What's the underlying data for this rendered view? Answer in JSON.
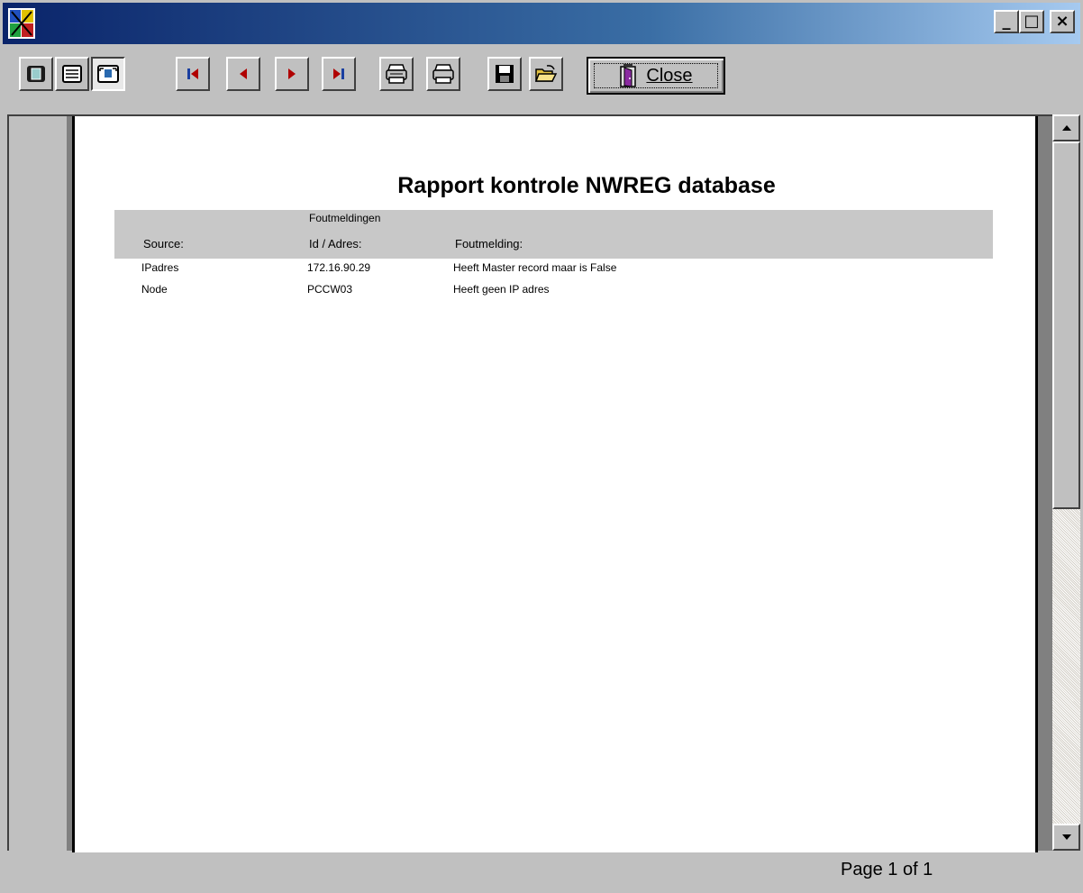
{
  "window": {
    "title": "",
    "controls": {
      "minimize": "_",
      "maximize": "□",
      "close": "×"
    }
  },
  "toolbar": {
    "buttons": [
      {
        "name": "one-page-view",
        "icon": "single-page-icon"
      },
      {
        "name": "list-view",
        "icon": "list-lines-icon"
      },
      {
        "name": "zoom-view",
        "icon": "zoom-page-icon"
      },
      {
        "name": "first-page",
        "icon": "first-page-icon"
      },
      {
        "name": "previous-page",
        "icon": "previous-page-icon"
      },
      {
        "name": "next-page",
        "icon": "next-page-icon"
      },
      {
        "name": "last-page",
        "icon": "last-page-icon"
      },
      {
        "name": "print-setup",
        "icon": "printer-setup-icon"
      },
      {
        "name": "print",
        "icon": "printer-icon"
      },
      {
        "name": "save",
        "icon": "floppy-disk-icon"
      },
      {
        "name": "open",
        "icon": "open-folder-icon"
      }
    ],
    "close_label": "Close",
    "colors": {
      "nav_arrow": "#b00000",
      "nav_arrow_first": "#1a3fa0"
    }
  },
  "report": {
    "title": "Rapport kontrole NWREG database",
    "band_caption": "Foutmeldingen",
    "columns": [
      "Source:",
      "Id / Adres:",
      "Foutmelding:"
    ],
    "rows": [
      [
        "IPadres",
        "172.16.90.29",
        "Heeft Master record maar is False"
      ],
      [
        "Node",
        "PCCW03",
        "Heeft geen IP adres"
      ]
    ]
  },
  "status": {
    "page_indicator": "Page 1 of 1"
  },
  "colors": {
    "titlebar_start": "#0a246a",
    "titlebar_end": "#a6caf0",
    "chrome": "#c0c0c0",
    "paper": "#ffffff",
    "header_band": "#c8c8c8"
  }
}
